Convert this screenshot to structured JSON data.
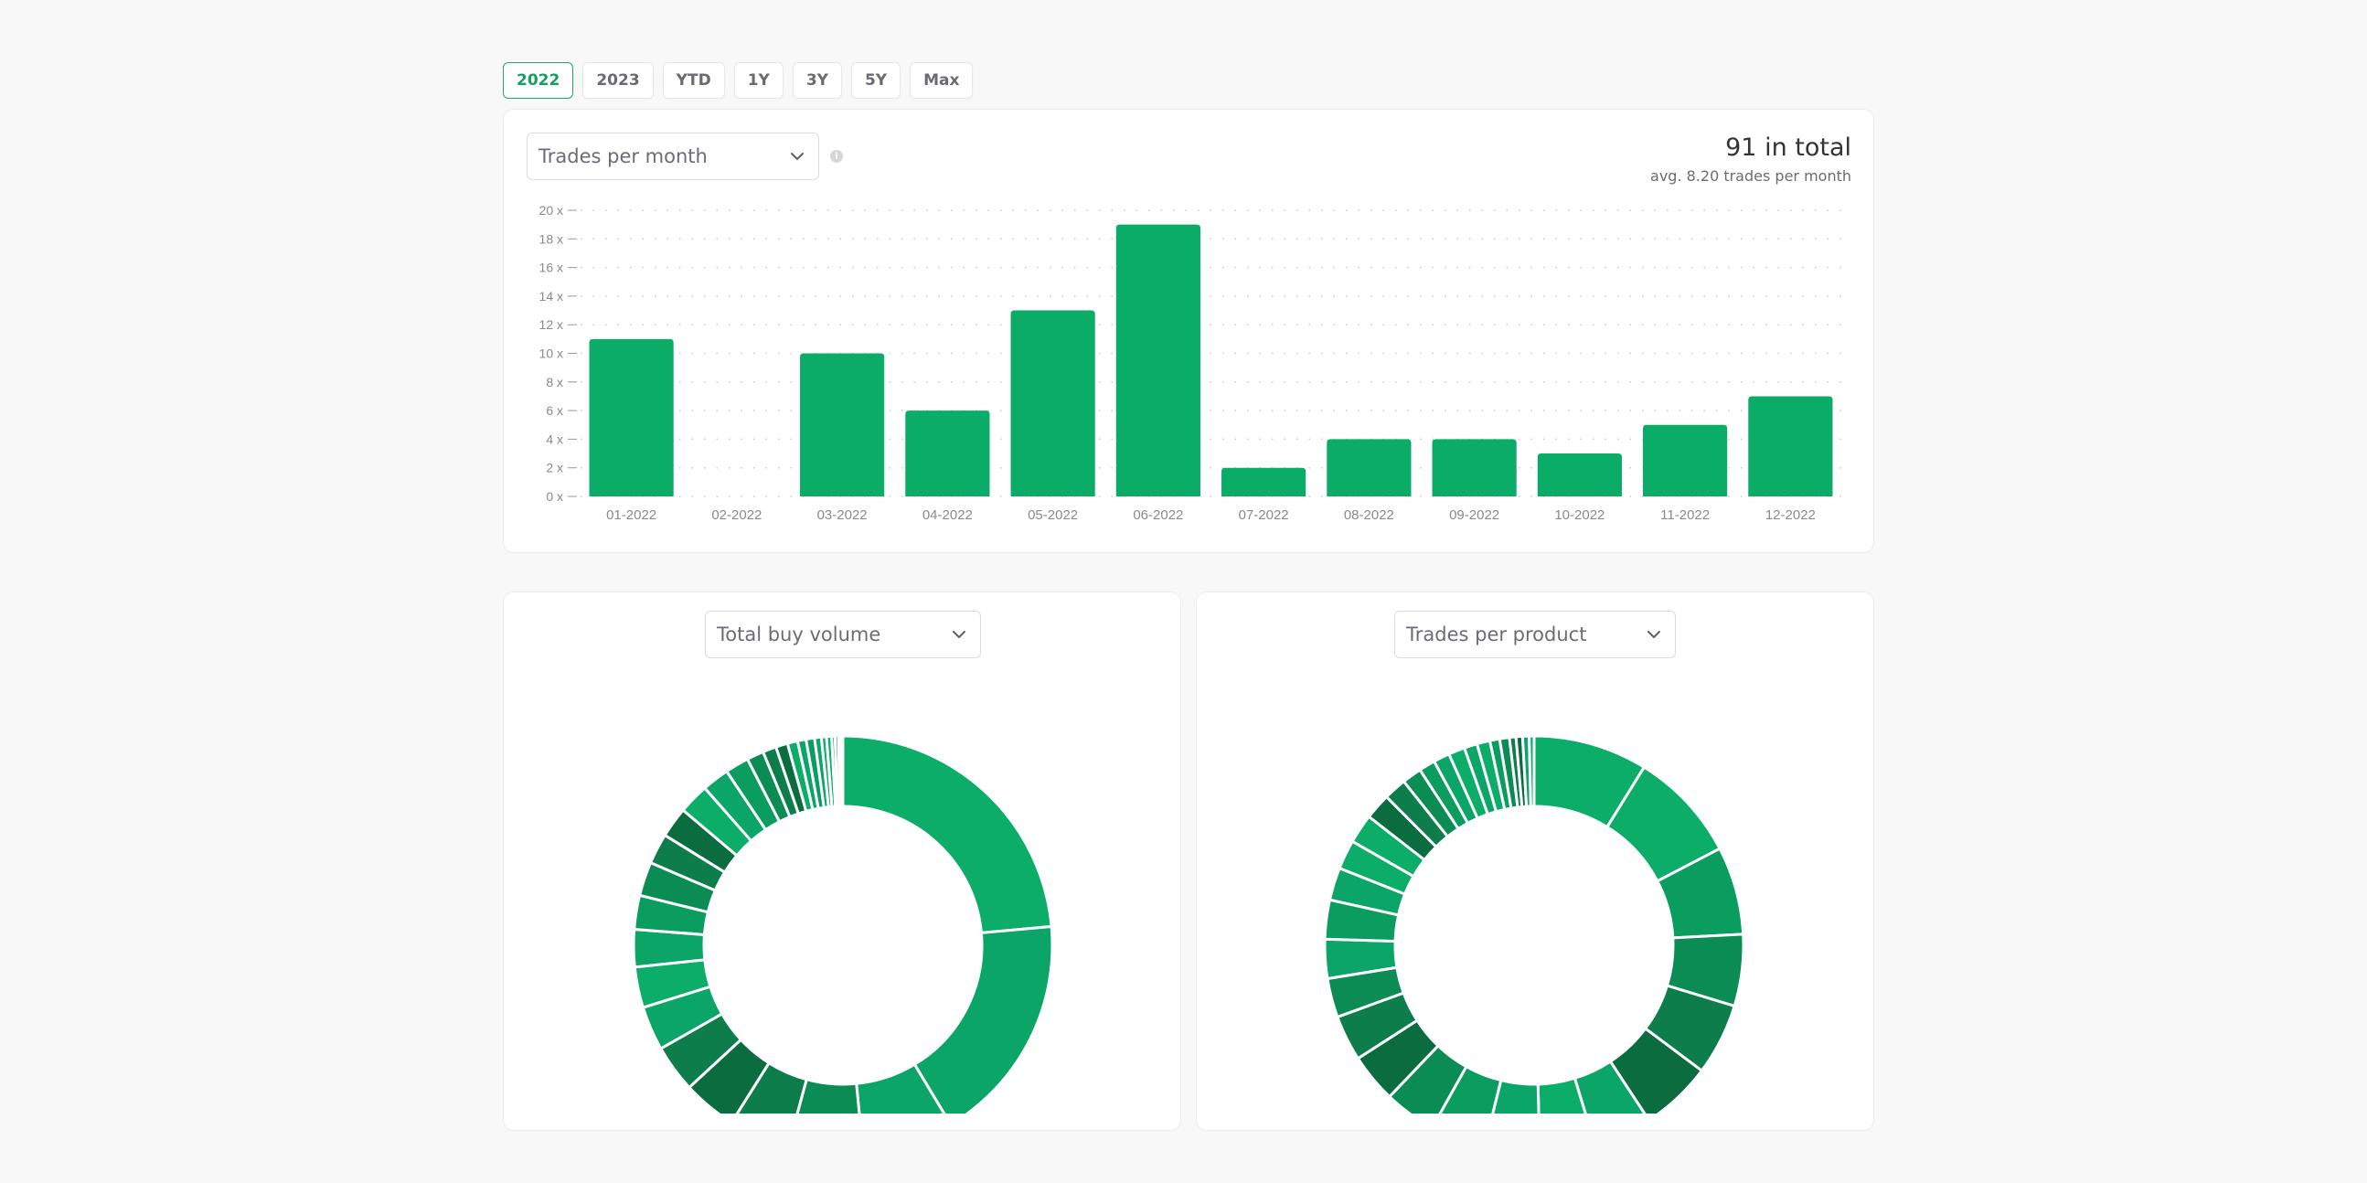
{
  "range_tabs": [
    {
      "label": "2022",
      "active": true
    },
    {
      "label": "2023",
      "active": false
    },
    {
      "label": "YTD",
      "active": false
    },
    {
      "label": "1Y",
      "active": false
    },
    {
      "label": "3Y",
      "active": false
    },
    {
      "label": "5Y",
      "active": false
    },
    {
      "label": "Max",
      "active": false
    }
  ],
  "top_card": {
    "select_value": "Trades per month",
    "info_icon": "info-icon",
    "total_label": "91 in total",
    "avg_label": "avg. 8.20 trades per month"
  },
  "left_card": {
    "select_value": "Total buy volume"
  },
  "right_card": {
    "select_value": "Trades per product"
  },
  "colors": {
    "accent": "#0bac68",
    "bar": "#0bac68",
    "donut_palette": [
      "#0cad69",
      "#0ba567",
      "#0b9c5f",
      "#0b8c55",
      "#0c7d4b",
      "#0b6c3f"
    ]
  },
  "chart_data": [
    {
      "type": "bar",
      "title": "Trades per month",
      "categories": [
        "01-2022",
        "02-2022",
        "03-2022",
        "04-2022",
        "05-2022",
        "06-2022",
        "07-2022",
        "08-2022",
        "09-2022",
        "10-2022",
        "11-2022",
        "12-2022"
      ],
      "values": [
        11,
        0,
        10,
        6,
        13,
        19,
        2,
        4,
        4,
        3,
        5,
        7
      ],
      "xlabel": "",
      "ylabel": "",
      "ylim": [
        0,
        20
      ],
      "yticks": [
        0,
        2,
        4,
        6,
        8,
        10,
        12,
        14,
        16,
        18,
        20
      ],
      "ytick_suffix": " x",
      "grid": true
    },
    {
      "type": "pie",
      "donut": true,
      "title": "Total buy volume",
      "values": [
        90,
        68,
        27,
        22,
        18,
        16,
        14,
        13,
        12,
        11,
        10,
        10,
        9,
        9,
        9,
        8,
        7,
        5,
        4,
        3.5,
        3,
        2.5,
        2.5,
        2,
        1.5,
        1.5,
        1,
        1,
        0.8,
        0.5
      ],
      "colors": [
        0,
        1,
        1,
        3,
        4,
        5,
        4,
        1,
        0,
        1,
        2,
        3,
        4,
        5,
        0,
        1,
        2,
        3,
        4,
        5,
        0,
        1,
        2,
        1,
        0,
        0,
        1,
        2,
        3,
        4
      ]
    },
    {
      "type": "pie",
      "donut": true,
      "title": "Trades per product",
      "values": [
        35,
        34,
        27,
        22,
        22,
        22,
        18,
        17,
        17,
        17,
        16,
        15,
        14,
        12,
        12,
        12,
        10,
        9,
        9,
        8,
        7,
        6,
        5,
        5,
        5,
        4,
        4,
        3,
        3,
        2,
        2,
        2,
        1.5
      ],
      "colors": [
        0,
        0,
        2,
        3,
        4,
        5,
        1,
        0,
        1,
        2,
        3,
        5,
        4,
        3,
        1,
        2,
        1,
        0,
        0,
        5,
        4,
        3,
        2,
        1,
        0,
        1,
        0,
        2,
        3,
        4,
        5,
        1,
        0
      ]
    }
  ]
}
